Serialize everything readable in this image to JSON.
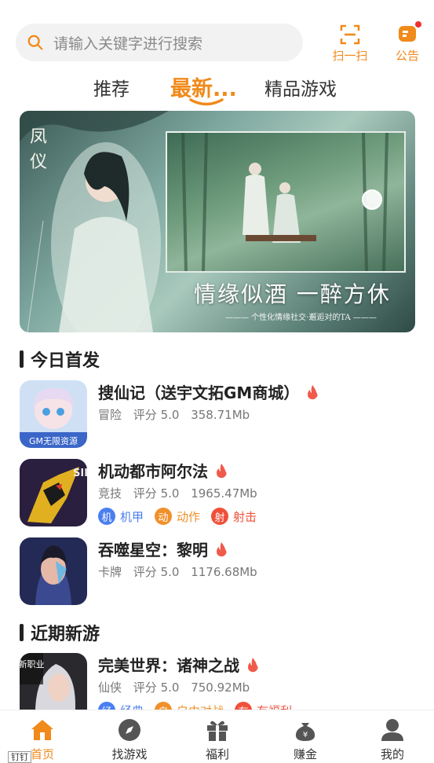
{
  "search": {
    "placeholder": "请输入关键字进行搜索"
  },
  "header": {
    "scan_label": "扫一扫",
    "notice_label": "公告"
  },
  "tabs": [
    {
      "label": "推荐",
      "active": false
    },
    {
      "label": "最新...",
      "active": true
    },
    {
      "label": "精品游戏",
      "active": false
    }
  ],
  "banner": {
    "game_title": "凤仪",
    "slogan": "情缘似酒 一醉方休",
    "subslogan": "——— 个性化情缘社交·邂逅对的TA ———"
  },
  "sections": {
    "today": "今日首发",
    "recent": "近期新游"
  },
  "games": [
    {
      "name": "搜仙记（送宇文拓GM商城）",
      "genre": "冒险",
      "rating": "评分 5.0",
      "size": "358.71Mb",
      "icon_badge": "GM无限资源",
      "tags": []
    },
    {
      "name": "机动都市阿尔法",
      "genre": "竞技",
      "rating": "评分 5.0",
      "size": "1965.47Mb",
      "tags": [
        {
          "glyph": "机",
          "label": "机甲",
          "color": "#4a7ff0"
        },
        {
          "glyph": "动",
          "label": "动作",
          "color": "#f0902a"
        },
        {
          "glyph": "射",
          "label": "射击",
          "color": "#f0503a"
        }
      ]
    },
    {
      "name": "吞噬星空：黎明",
      "genre": "卡牌",
      "rating": "评分 5.0",
      "size": "1176.68Mb",
      "tags": []
    },
    {
      "name": "完美世界：诸神之战",
      "genre": "仙侠",
      "rating": "评分 5.0",
      "size": "750.92Mb",
      "icon_badge": "新职业",
      "tags": [
        {
          "glyph": "经",
          "label": "经典",
          "color": "#4a7ff0"
        },
        {
          "glyph": "自",
          "label": "自由对战",
          "color": "#f0902a"
        },
        {
          "glyph": "有",
          "label": "有福利",
          "color": "#f0503a"
        }
      ]
    }
  ],
  "nav": {
    "home": "首页",
    "find": "找游戏",
    "welfare": "福利",
    "earn": "赚金",
    "me": "我的"
  },
  "pin_label": "钉钉",
  "colors": {
    "accent": "#f08a1a",
    "fire": "#f05a4a"
  }
}
